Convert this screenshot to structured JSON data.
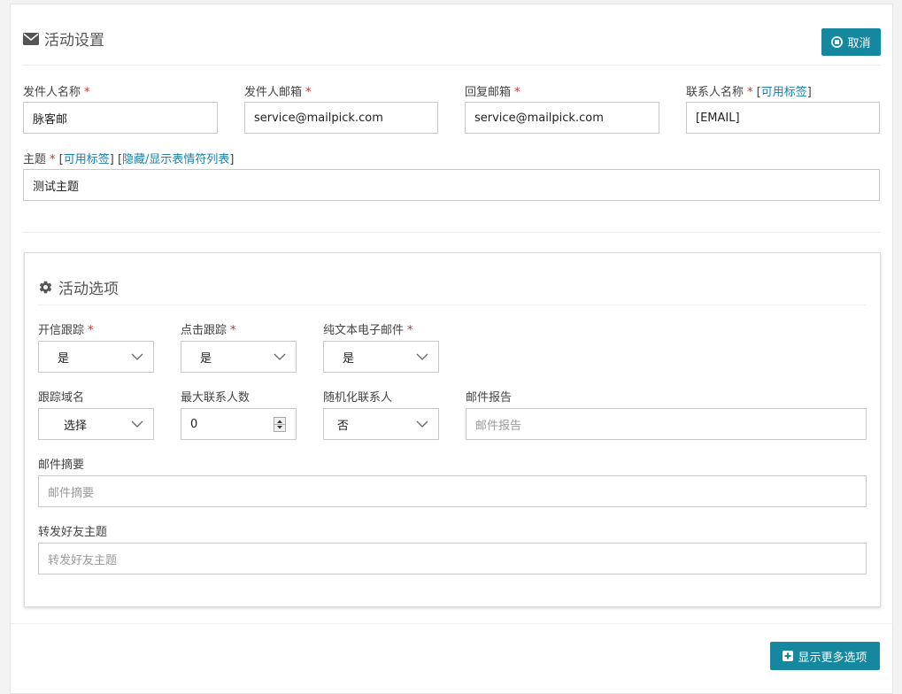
{
  "header": {
    "icon": "envelope-icon",
    "title": "活动设置",
    "cancel_label": "取消",
    "cancel_icon": "close-circle-icon"
  },
  "fields": {
    "sender_name": {
      "label": "发件人名称",
      "required": "*",
      "value": "脉客邮"
    },
    "sender_email": {
      "label": "发件人邮箱",
      "required": "*",
      "value": "service@mailpick.com"
    },
    "reply_email": {
      "label": "回复邮箱",
      "required": "*",
      "value": "service@mailpick.com"
    },
    "contact_name": {
      "label": "联系人名称",
      "required": "*",
      "tags_link": "可用标签",
      "value": "[EMAIL]"
    },
    "subject": {
      "label": "主题",
      "required": "*",
      "tags_link": "可用标签",
      "emoji_link": "隐藏/显示表情符列表",
      "value": "测试主题"
    }
  },
  "options": {
    "icon": "gear-icon",
    "title": "活动选项",
    "open_tracking": {
      "label": "开信跟踪",
      "required": "*",
      "value": "是"
    },
    "click_tracking": {
      "label": "点击跟踪",
      "required": "*",
      "value": "是"
    },
    "plain_text": {
      "label": "纯文本电子邮件",
      "required": "*",
      "value": "是"
    },
    "tracking_domain": {
      "label": "跟踪域名",
      "value": "选择"
    },
    "max_contacts": {
      "label": "最大联系人数",
      "value": "0"
    },
    "randomize": {
      "label": "随机化联系人",
      "value": "否"
    },
    "report": {
      "label": "邮件报告",
      "placeholder": "邮件报告"
    },
    "summary": {
      "label": "邮件摘要",
      "placeholder": "邮件摘要"
    },
    "forward_subject": {
      "label": "转发好友主题",
      "placeholder": "转发好友主题"
    }
  },
  "footer": {
    "more_label": "显示更多选项",
    "more_icon": "plus-square-icon"
  },
  "colors": {
    "accent": "#1588a0",
    "link": "#1a7fa8",
    "required": "#c9302c"
  }
}
